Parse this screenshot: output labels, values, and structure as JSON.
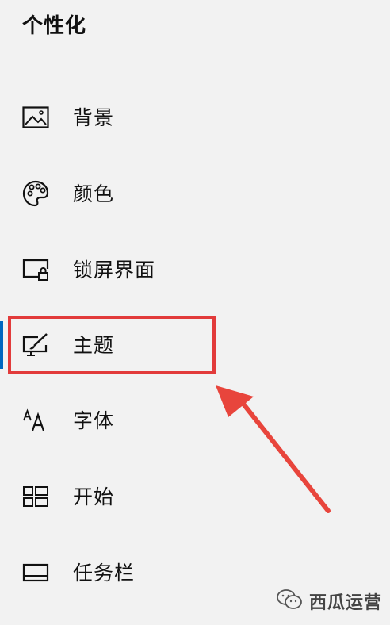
{
  "header": {
    "title": "个性化"
  },
  "nav": {
    "items": [
      {
        "label": "背景",
        "icon": "picture-icon"
      },
      {
        "label": "颜色",
        "icon": "palette-icon"
      },
      {
        "label": "锁屏界面",
        "icon": "lock-screen-icon"
      },
      {
        "label": "主题",
        "icon": "theme-brush-icon"
      },
      {
        "label": "字体",
        "icon": "font-icon"
      },
      {
        "label": "开始",
        "icon": "start-grid-icon"
      },
      {
        "label": "任务栏",
        "icon": "taskbar-icon"
      }
    ],
    "selected": "主题"
  },
  "annotation": {
    "highlight_color": "#e23b3b",
    "accent_color": "#0067c0"
  },
  "watermark": {
    "text": "西瓜运营",
    "icon": "wechat-icon"
  }
}
